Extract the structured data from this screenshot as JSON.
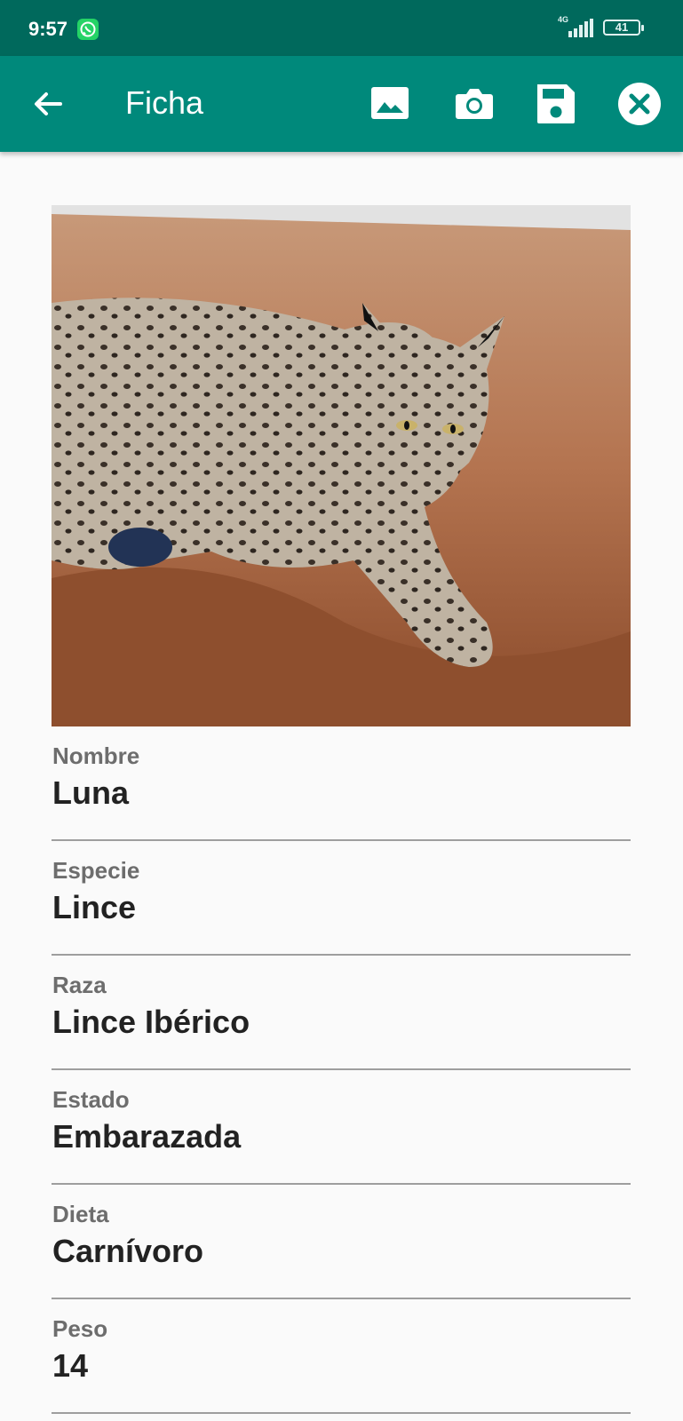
{
  "status_bar": {
    "time": "9:57",
    "network": "4G",
    "battery": "41",
    "notification_icon": "whatsapp-icon"
  },
  "app_bar": {
    "title": "Ficha",
    "back_icon": "arrow-back-icon",
    "actions": [
      "image-icon",
      "camera-icon",
      "save-icon",
      "close-circle-icon"
    ],
    "color": "#00897b",
    "status_color": "#00695c"
  },
  "photo": {
    "description_icon": "photo"
  },
  "fields": [
    {
      "label": "Nombre",
      "value": "Luna"
    },
    {
      "label": "Especie",
      "value": "Lince"
    },
    {
      "label": "Raza",
      "value": "Lince Ibérico"
    },
    {
      "label": "Estado",
      "value": "Embarazada"
    },
    {
      "label": "Dieta",
      "value": "Carnívoro"
    },
    {
      "label": "Peso",
      "value": "14"
    }
  ]
}
